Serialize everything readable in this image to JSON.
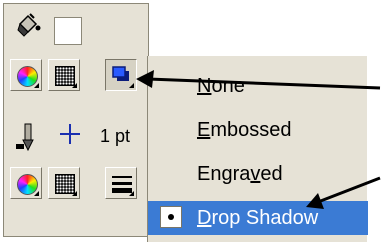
{
  "toolbar": {
    "buttons": [
      {
        "name": "fill-color-icon"
      },
      {
        "name": "color-picker-button"
      },
      {
        "name": "fill-pattern-button"
      },
      {
        "name": "effects-button"
      },
      {
        "name": "stroke-color-icon"
      },
      {
        "name": "stroke-style-icon"
      },
      {
        "name": "stroke-color-picker-button"
      },
      {
        "name": "stroke-pattern-button"
      },
      {
        "name": "line-weight-button"
      }
    ],
    "stroke_width_label": "1 pt"
  },
  "menu": {
    "items": [
      {
        "label_pre": "",
        "label_mnemonic": "N",
        "label_post": "one",
        "selected": false,
        "checked": false
      },
      {
        "label_pre": "",
        "label_mnemonic": "E",
        "label_post": "mbossed",
        "selected": false,
        "checked": false
      },
      {
        "label_pre": "Engra",
        "label_mnemonic": "v",
        "label_post": "ed",
        "selected": false,
        "checked": false
      },
      {
        "label_pre": "",
        "label_mnemonic": "D",
        "label_post": "rop Shadow",
        "selected": true,
        "checked": true
      }
    ]
  },
  "colors": {
    "panel_bg": "#e6e2d6",
    "selection": "#3b7bd4",
    "annotation_arrow": "#000000"
  }
}
